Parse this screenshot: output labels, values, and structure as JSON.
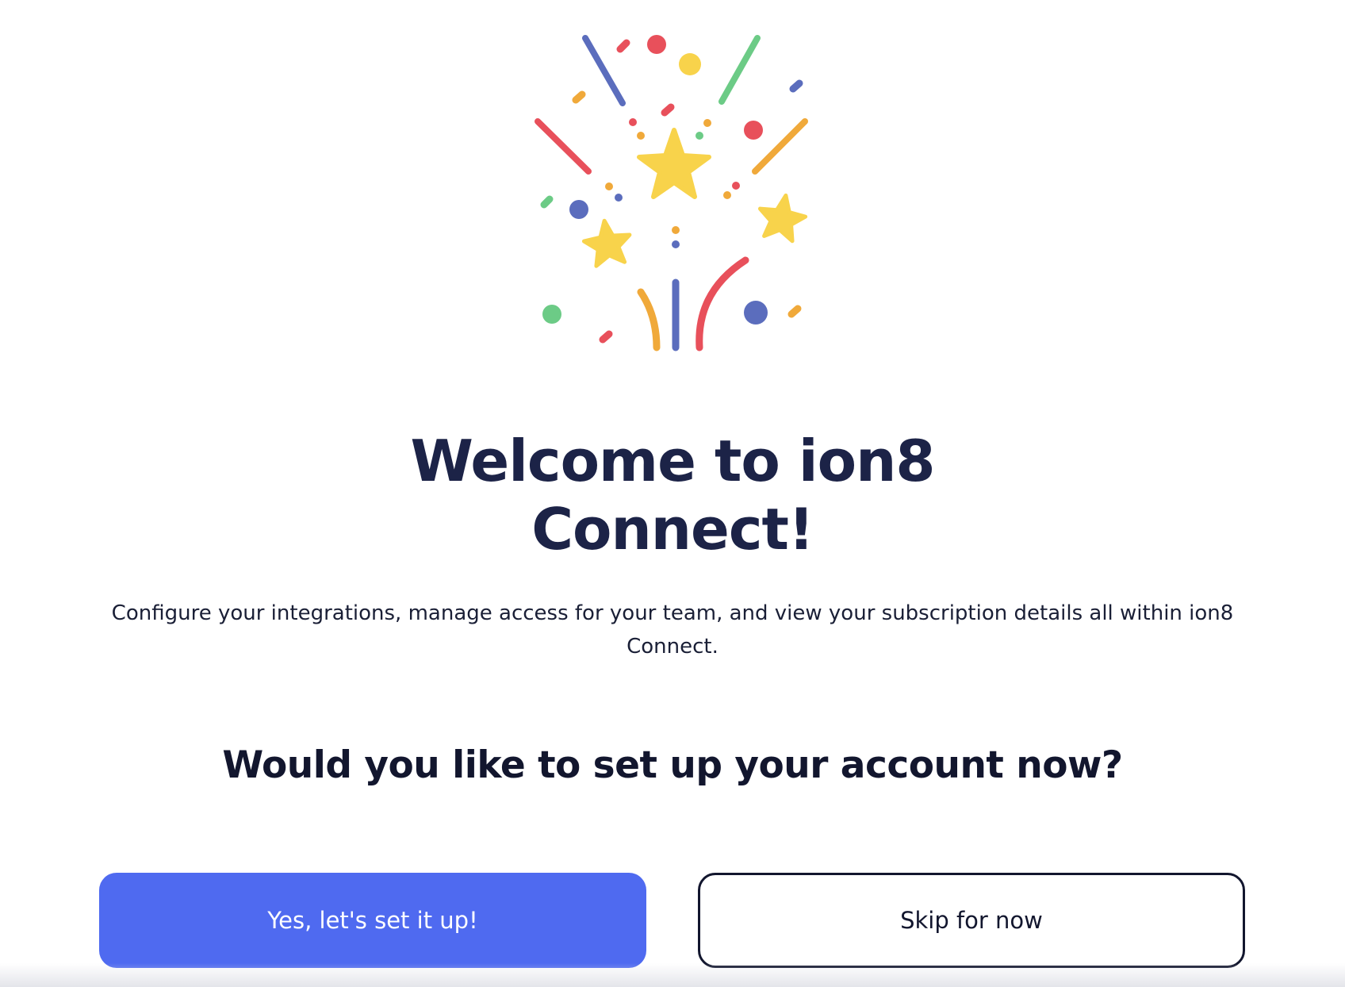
{
  "illustration": {
    "icon": "celebration-confetti-icon",
    "colors": {
      "blue": "#5b6dbd",
      "red": "#e8505b",
      "yellow": "#f8d34b",
      "green": "#6ccb86",
      "orange": "#f0a93a"
    }
  },
  "welcome": {
    "title_line1": "Welcome to ion8",
    "title_line2": "Connect!",
    "description": "Configure your integrations, manage access for your team, and view your subscription details all within ion8 Connect."
  },
  "setup": {
    "question": "Would you like to set up your account now?",
    "confirm_label": "Yes, let's set it up!",
    "skip_label": "Skip for now"
  },
  "colors": {
    "primary": "#4f6af0",
    "heading": "#1c2347",
    "text": "#1a1f36"
  }
}
